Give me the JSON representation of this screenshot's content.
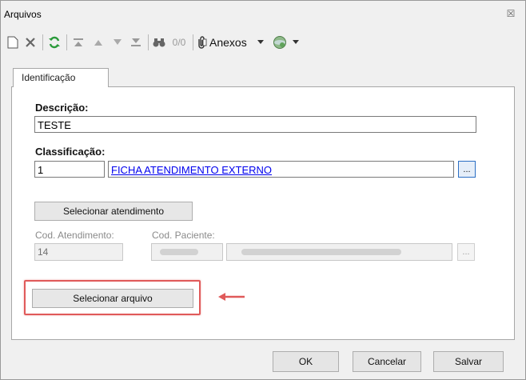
{
  "window": {
    "title": "Arquivos",
    "close_glyph": "☒"
  },
  "toolbar": {
    "record_counter": "0/0",
    "anexos_label": "Anexos",
    "icons": [
      "new-document-icon",
      "delete-icon",
      "refresh-icon",
      "first-record-icon",
      "previous-record-icon",
      "next-record-icon",
      "last-record-icon",
      "search-binoculars-icon",
      "attachment-icon",
      "dropdown-arrow-icon",
      "globe-icon"
    ]
  },
  "tabs": [
    {
      "label": "Identificação"
    }
  ],
  "form": {
    "descricao_label": "Descrição:",
    "descricao_value": "TESTE",
    "classificacao_label": "Classificação:",
    "classificacao_code": "1",
    "classificacao_name": "FICHA ATENDIMENTO EXTERNO",
    "lookup_button": "...",
    "selecionar_atendimento_label": "Selecionar atendimento",
    "cod_atendimento_label": "Cod. Atendimento:",
    "cod_atendimento_value": "14",
    "cod_paciente_label": "Cod. Paciente:",
    "paciente_lookup_button": "...",
    "selecionar_arquivo_label": "Selecionar arquivo"
  },
  "footer": {
    "ok_label": "OK",
    "cancelar_label": "Cancelar",
    "salvar_label": "Salvar"
  },
  "colors": {
    "highlight": "#e05a5a",
    "link": "#0000ee",
    "accent": "#2b6fc4"
  }
}
